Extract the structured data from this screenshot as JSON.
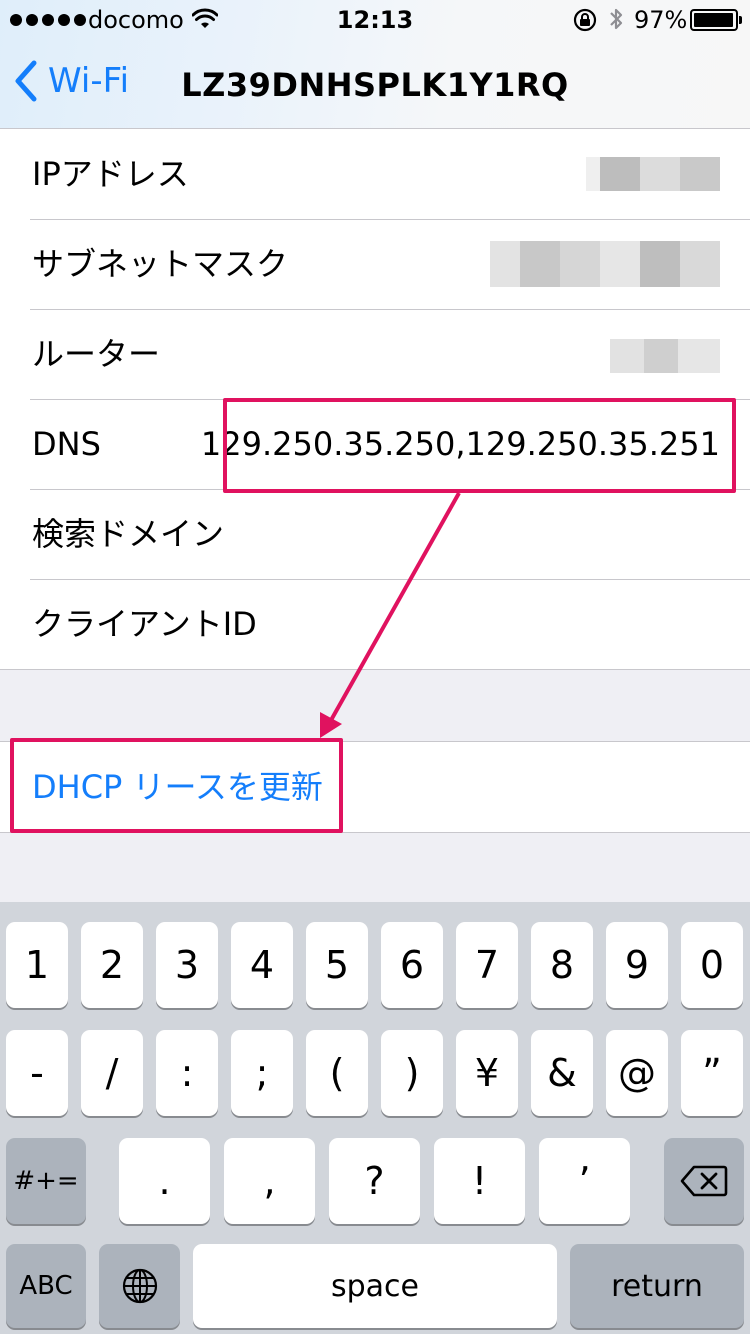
{
  "status_bar": {
    "carrier": "docomo",
    "time": "12:13",
    "battery_percent": "97%",
    "icons": [
      "signal-dots",
      "wifi-icon",
      "orientation-lock-icon",
      "bluetooth-icon",
      "battery-icon"
    ]
  },
  "nav": {
    "back_label": "Wi-Fi",
    "title": "LZ39DNHSPLK1Y1RQ"
  },
  "rows": [
    {
      "label": "IPアドレス",
      "value": ""
    },
    {
      "label": "サブネットマスク",
      "value": ""
    },
    {
      "label": "ルーター",
      "value": ""
    },
    {
      "label": "DNS",
      "value": "129.250.35.250,129.250.35.251"
    },
    {
      "label": "検索ドメイン",
      "value": ""
    },
    {
      "label": "クライアントID",
      "value": ""
    }
  ],
  "renew_label": "DHCP リースを更新",
  "keyboard": {
    "row1": [
      "1",
      "2",
      "3",
      "4",
      "5",
      "6",
      "7",
      "8",
      "9",
      "0"
    ],
    "row2": [
      "-",
      "/",
      ":",
      ";",
      "(",
      ")",
      "¥",
      "&",
      "@",
      "”"
    ],
    "row3_left": "#+=",
    "row3": [
      ".",
      ",",
      "?",
      "!",
      "’"
    ],
    "abc": "ABC",
    "space": "space",
    "return": "return"
  },
  "colors": {
    "accent": "#147efb",
    "annotation": "#e0125f",
    "group_background": "#efeff4",
    "keyboard_background": "#d1d5db"
  }
}
